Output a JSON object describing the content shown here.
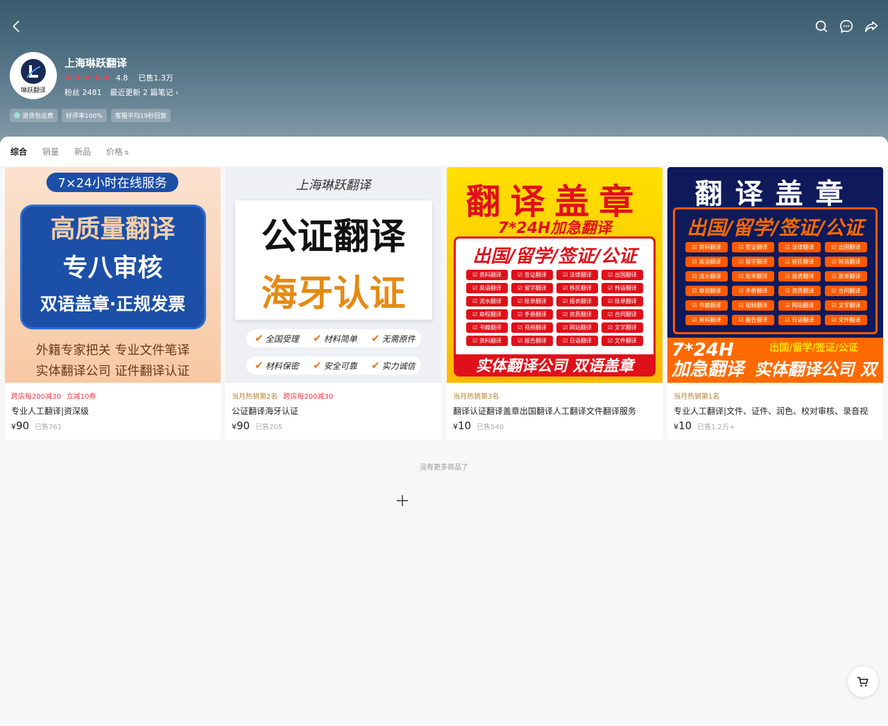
{
  "shop": {
    "name": "上海琳跃翻译",
    "logo_text": "琳跃翻译",
    "rating": "4.8",
    "sold": "已售1.3万",
    "fans": "粉丝 2481",
    "recent": "最近更新 2 篇笔记",
    "badges": [
      "退货包运费",
      "好评率100%",
      "客服平均19秒回复"
    ]
  },
  "sort": {
    "items": [
      "综合",
      "销量",
      "新品",
      "价格"
    ],
    "active": "综合"
  },
  "products": [
    {
      "tags": [
        "跨店每200减30",
        "立减10券"
      ],
      "title": "专业人工翻译|资深级",
      "price_symbol": "¥",
      "price": "90",
      "sold": "已售761",
      "image": {
        "pill": "7×24小时在线服务",
        "line1": "高质量翻译",
        "line2": "专八审核",
        "line3": "双语盖章·正规发票",
        "line4": "外籍专家把关  专业文件笔译",
        "line5": "实体翻译公司  证件翻译认证"
      }
    },
    {
      "rank": "当月热销第2名",
      "tags": [
        "跨店每200减30"
      ],
      "title": "公证翻译海牙认证",
      "price_symbol": "¥",
      "price": "90",
      "sold": "已售205",
      "image": {
        "brand": "上海琳跃翻译",
        "line1": "公证翻译",
        "line2": "海牙认证",
        "features": [
          "全国受理",
          "材料简单",
          "无需原件",
          "材料保密",
          "安全可靠",
          "实力诚信"
        ]
      }
    },
    {
      "rank": "当月热销第3名",
      "title": "翻译认证翻译盖章出国翻译人工翻译文件翻译服务",
      "price_symbol": "¥",
      "price": "10",
      "sold": "已售540",
      "image": {
        "title": "翻译盖章",
        "subtitle": "7*24H加急翻译",
        "heading": "出国/留学/签证/公证",
        "chips": [
          "资料翻译",
          "签证翻译",
          "法律翻译",
          "出国翻译",
          "英语翻译",
          "留学翻译",
          "移民翻译",
          "韩语翻译",
          "流水翻译",
          "账单翻译",
          "报表翻译",
          "账单翻译",
          "章程翻译",
          "手册翻译",
          "资质翻译",
          "合同翻译",
          "书籍翻译",
          "视频翻译",
          "网站翻译",
          "文学翻译",
          "资料翻译",
          "报告翻译",
          "日语翻译",
          "文件翻译"
        ],
        "bottom": "实体翻译公司  双语盖章"
      }
    },
    {
      "rank": "当月热销第1名",
      "title": "专业人工翻译|文件、证件、润色、校对审核、录音视",
      "price_symbol": "¥",
      "price": "10",
      "sold": "已售1.2万+",
      "image": {
        "title": "翻译盖章",
        "heading": "出国/留学/签证/公证",
        "chips": [
          "资料翻译",
          "签证翻译",
          "法律翻译",
          "出国翻译",
          "英语翻译",
          "留学翻译",
          "移民翻译",
          "韩语翻译",
          "流水翻译",
          "账单翻译",
          "报表翻译",
          "账单翻译",
          "章程翻译",
          "手册翻译",
          "资质翻译",
          "合同翻译",
          "书籍翻译",
          "视频翻译",
          "网站翻译",
          "文学翻译",
          "资料翻译",
          "报告翻译",
          "日语翻译",
          "文件翻译"
        ],
        "bottom_left": "7*24H 加急翻译",
        "bottom_top": "出国/留学/签证/公证",
        "bottom_right": "实体翻译公司 双语盖章"
      }
    }
  ],
  "footer": {
    "end_text": "没有更多商品了"
  },
  "colors": {
    "accent_red": "#e8383d",
    "rank_gold": "#b6822e",
    "header_bg": "#4e6f81"
  }
}
